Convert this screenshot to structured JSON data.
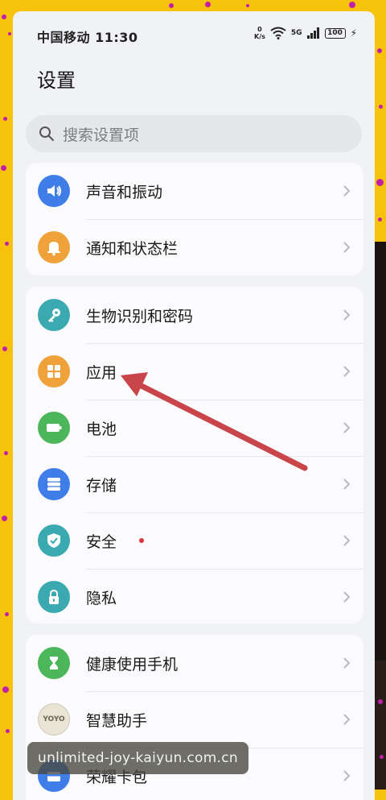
{
  "status_bar": {
    "carrier_time": "中国移动 11:30",
    "speed_value": "0",
    "speed_unit": "K/s",
    "network": "5G",
    "battery": "100"
  },
  "page_title": "设置",
  "search": {
    "placeholder": "搜索设置项"
  },
  "groups": [
    {
      "items": [
        {
          "label": "声音和振动",
          "icon": "volume-icon",
          "color": "#3f7ee8"
        },
        {
          "label": "通知和状态栏",
          "icon": "bell-icon",
          "color": "#f0a23a"
        }
      ]
    },
    {
      "items": [
        {
          "label": "生物识别和密码",
          "icon": "key-icon",
          "color": "#3aa9b0"
        },
        {
          "label": "应用",
          "icon": "apps-grid-icon",
          "color": "#f0a23a"
        },
        {
          "label": "电池",
          "icon": "battery-icon",
          "color": "#4bb65a"
        },
        {
          "label": "存储",
          "icon": "storage-icon",
          "color": "#3f7ee8"
        },
        {
          "label": "安全",
          "icon": "shield-icon",
          "color": "#3aa9b0",
          "badge": true
        },
        {
          "label": "隐私",
          "icon": "lock-icon",
          "color": "#3aa9b0"
        }
      ]
    },
    {
      "items": [
        {
          "label": "健康使用手机",
          "icon": "hourglass-icon",
          "color": "#4bb65a"
        },
        {
          "label": "智慧助手",
          "icon": "yoyo-icon",
          "icon_text": "YOYO",
          "color": "#e9e4d6"
        },
        {
          "label": "荣耀卡包",
          "icon": "wallet-icon",
          "color": "#3f7ee8"
        }
      ]
    }
  ],
  "watermark": "unlimited-joy-kaiyun.com.cn",
  "colors": {
    "arrow": "#c8454a",
    "background": "#f6c20c",
    "accent": "#c21fa8"
  }
}
